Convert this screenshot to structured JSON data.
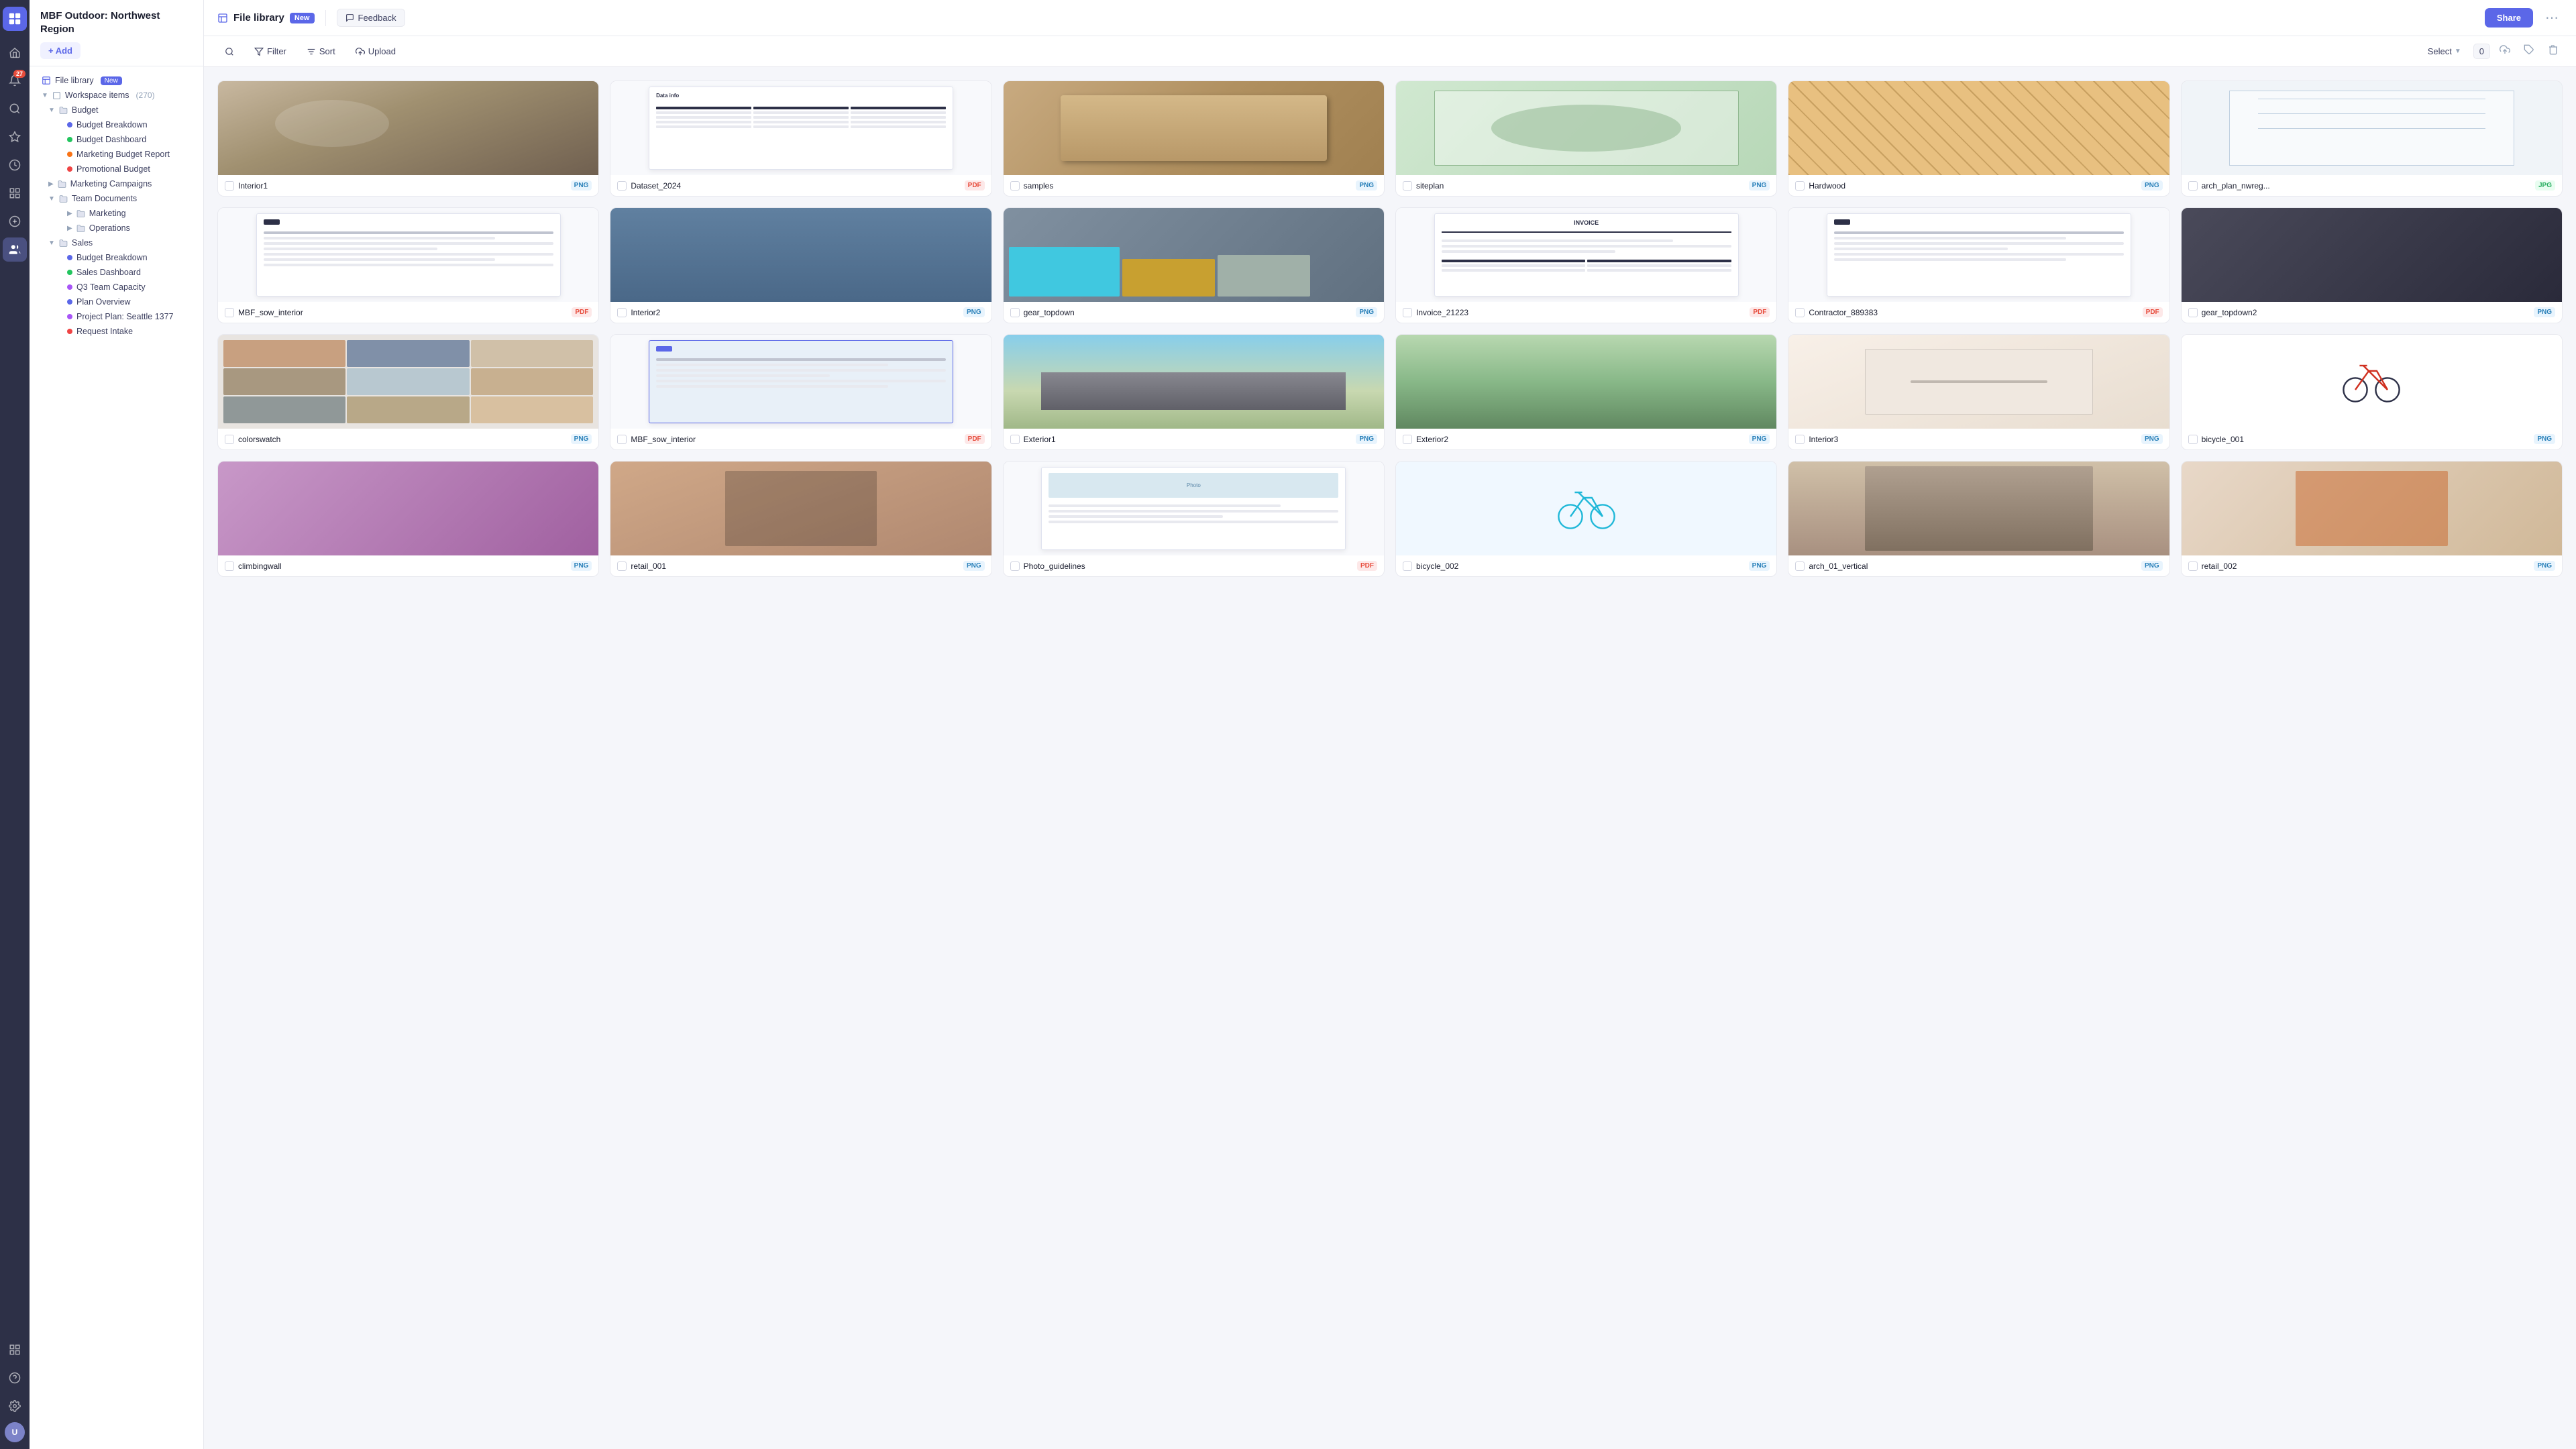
{
  "app": {
    "name": "MBF Outdoor",
    "workspace": "MBF Outdoor: Northwest Region"
  },
  "topbar": {
    "page_icon": "📁",
    "title": "File library",
    "title_badge": "New",
    "feedback_label": "Feedback",
    "share_label": "Share"
  },
  "toolbar": {
    "filter_label": "Filter",
    "sort_label": "Sort",
    "upload_label": "Upload",
    "select_label": "Select",
    "count": "0"
  },
  "sidebar": {
    "workspace_title": "MBF Outdoor: Northwest Region",
    "add_label": "+ Add",
    "file_library_label": "File library",
    "file_library_badge": "New",
    "workspace_items_label": "Workspace items",
    "workspace_items_count": "270",
    "budget": {
      "label": "Budget",
      "items": [
        {
          "label": "Budget Breakdown",
          "color": "blue"
        },
        {
          "label": "Budget Dashboard",
          "color": "green"
        },
        {
          "label": "Marketing Budget Report",
          "color": "orange"
        },
        {
          "label": "Promotional Budget",
          "color": "red"
        }
      ]
    },
    "marketing_campaigns": {
      "label": "Marketing Campaigns"
    },
    "team_documents": {
      "label": "Team Documents",
      "items": [
        {
          "label": "Marketing"
        },
        {
          "label": "Operations"
        }
      ]
    },
    "sales": {
      "label": "Sales",
      "items": [
        {
          "label": "Budget Breakdown",
          "color": "blue"
        },
        {
          "label": "Sales Dashboard",
          "color": "green"
        },
        {
          "label": "Q3 Team Capacity",
          "color": "purple"
        },
        {
          "label": "Plan Overview",
          "color": "blue"
        },
        {
          "label": "Project Plan: Seattle 1377",
          "color": "purple"
        },
        {
          "label": "Request Intake",
          "color": "red"
        }
      ]
    }
  },
  "files": [
    {
      "name": "Interior1",
      "type": "PNG",
      "thumb": "photo-interior"
    },
    {
      "name": "Dataset_2024",
      "type": "PDF",
      "thumb": "doc-table"
    },
    {
      "name": "samples",
      "type": "PNG",
      "thumb": "wood"
    },
    {
      "name": "siteplan",
      "type": "PNG",
      "thumb": "blueprint-site"
    },
    {
      "name": "Hardwood",
      "type": "PNG",
      "thumb": "hardwood-curve"
    },
    {
      "name": "arch_plan_nwreg...",
      "type": "JPG",
      "thumb": "blueprint-arch"
    },
    {
      "name": "MBF_sow_interior",
      "type": "PDF",
      "thumb": "doc-sow"
    },
    {
      "name": "Interior2",
      "type": "PNG",
      "thumb": "photo-interior2"
    },
    {
      "name": "gear_topdown",
      "type": "PNG",
      "thumb": "photo-gear"
    },
    {
      "name": "Invoice_21223",
      "type": "PDF",
      "thumb": "doc-invoice"
    },
    {
      "name": "Contractor_889383",
      "type": "PDF",
      "thumb": "doc-contractor"
    },
    {
      "name": "gear_topdown2",
      "type": "PNG",
      "thumb": "photo-tools"
    },
    {
      "name": "colorswatch",
      "type": "PNG",
      "thumb": "photo-color"
    },
    {
      "name": "MBF_sow_interior",
      "type": "PDF",
      "thumb": "doc-sow2"
    },
    {
      "name": "Exterior1",
      "type": "PNG",
      "thumb": "photo-exterior1"
    },
    {
      "name": "Exterior2",
      "type": "PNG",
      "thumb": "photo-exterior2"
    },
    {
      "name": "Interior3",
      "type": "PNG",
      "thumb": "photo-store"
    },
    {
      "name": "bicycle_001",
      "type": "PNG",
      "thumb": "photo-bike"
    },
    {
      "name": "climbingwall",
      "type": "PNG",
      "thumb": "photo-climbing"
    },
    {
      "name": "retail_001",
      "type": "PNG",
      "thumb": "photo-retail"
    },
    {
      "name": "Photo_guidelines",
      "type": "PDF",
      "thumb": "doc-photo"
    },
    {
      "name": "bicycle_002",
      "type": "PNG",
      "thumb": "photo-bike2"
    },
    {
      "name": "arch_01_vertical",
      "type": "PNG",
      "thumb": "photo-arch-v"
    },
    {
      "name": "retail_002",
      "type": "PNG",
      "thumb": "photo-retail2"
    }
  ],
  "nav_icons": {
    "home": "⌂",
    "search": "🔍",
    "inbox": "🔔",
    "star": "★",
    "clock": "🕐",
    "grid": "⊞",
    "users": "👤",
    "settings": "⚙",
    "question": "?",
    "grid_bottom": "⊞"
  }
}
